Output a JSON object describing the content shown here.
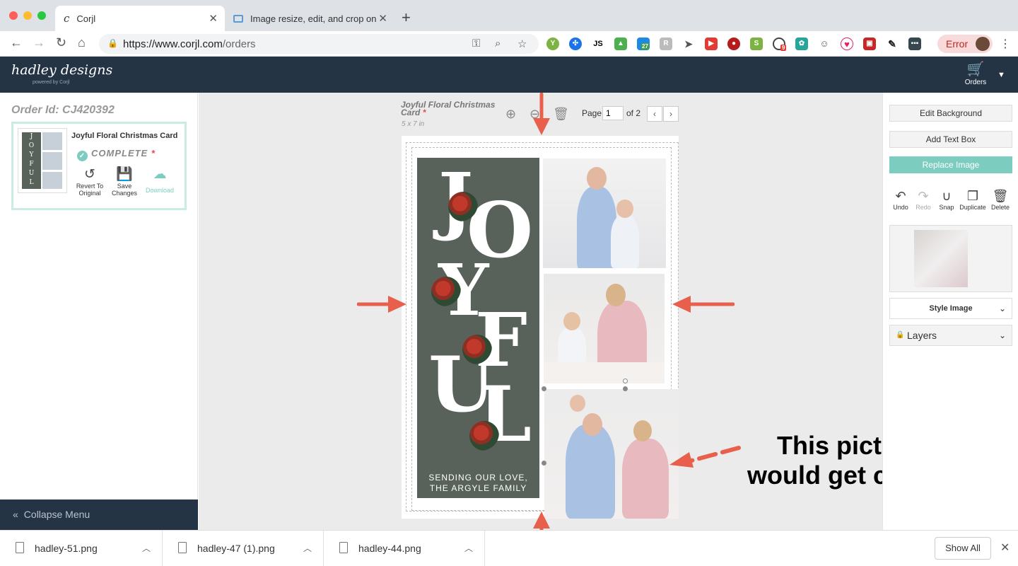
{
  "browser": {
    "tabs": [
      {
        "title": "Corjl",
        "close": "✕",
        "icon": "corjl-icon"
      },
      {
        "title": "Image resize, edit, and crop on",
        "close": "✕",
        "icon": "image-tab-icon"
      }
    ],
    "new_tab": "+",
    "url_host": "https://www.corjl.com",
    "url_path": "/orders",
    "error_label": "Error",
    "extension_badges": {
      "calendar": "27",
      "notifications": "9"
    }
  },
  "app": {
    "logo": "hadley designs",
    "logo_sub": "powered by Corjl",
    "orders_label": "Orders"
  },
  "left_panel": {
    "order_id": "Order Id: CJ420392",
    "card": {
      "title": "Joyful Floral Christmas Card",
      "status": "COMPLETE",
      "status_star": "*",
      "actions": [
        {
          "label": "Revert To Original",
          "icon": "revert-icon"
        },
        {
          "label": "Save Changes",
          "icon": "save-icon"
        },
        {
          "label": "Download",
          "icon": "cloud-download-icon"
        }
      ]
    },
    "collapse_label": "Collapse Menu"
  },
  "canvas": {
    "doc_title": "Joyful Floral Christmas Card",
    "doc_star": "*",
    "doc_size": "5 x 7 in",
    "page_label": "Page",
    "page_value": "1",
    "page_of": "of 2",
    "card_letters": [
      "J",
      "O",
      "Y",
      "F",
      "U",
      "L"
    ],
    "greeting": [
      "SENDING OUR LOVE,",
      "THE ARGYLE FAMILY"
    ],
    "callout": [
      "This picture",
      "would get cut off"
    ]
  },
  "right_panel": {
    "buttons": [
      "Edit Background",
      "Add Text Box",
      "Replace Image"
    ],
    "tools": [
      {
        "label": "Undo",
        "icon": "undo-icon",
        "enabled": true
      },
      {
        "label": "Redo",
        "icon": "redo-icon",
        "enabled": false
      },
      {
        "label": "Snap",
        "icon": "magnet-icon",
        "enabled": true
      },
      {
        "label": "Duplicate",
        "icon": "duplicate-icon",
        "enabled": true
      },
      {
        "label": "Delete",
        "icon": "trash-icon",
        "enabled": true
      }
    ],
    "style_image": "Style Image",
    "layers": "Layers"
  },
  "downloads": {
    "files": [
      "hadley-51.png",
      "hadley-47 (1).png",
      "hadley-44.png"
    ],
    "show_all": "Show All"
  },
  "colors": {
    "app_header": "#253445",
    "accent_teal": "#7ccdbf",
    "card_green": "#58625a",
    "annotation_arrow": "#e8604c"
  }
}
